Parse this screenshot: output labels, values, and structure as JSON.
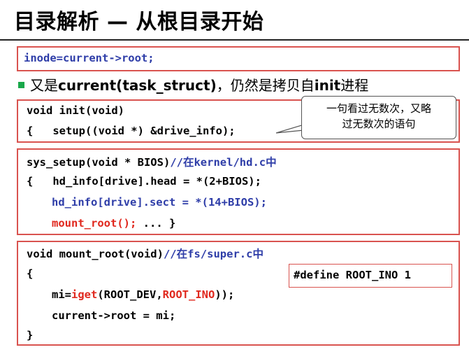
{
  "title": "目录解析 — 从根目录开始",
  "box1": {
    "line": "inode=current->root;"
  },
  "bullet": {
    "prefix": "又是",
    "mid": "current(task_struct)",
    "suffix": "，仍然是拷贝自",
    "bold": "init",
    "end": "进程"
  },
  "box2": {
    "line1": "void init(void)",
    "line2": "{   setup((void *) &drive_info);"
  },
  "callout": {
    "line1": "一句看过无数次，又略",
    "line2": "过无数次的语句"
  },
  "box3": {
    "line1_a": "sys_setup(void * BIOS)",
    "line1_b": "//在kernel/hd.c中",
    "line2": "{   hd_info[drive].head = *(2+BIOS);",
    "line3": "hd_info[drive].sect = *(14+BIOS);",
    "line4_a": "mount_root();",
    "line4_b": " ... }"
  },
  "box4": {
    "line1_a": "void mount_root(void)",
    "line1_b": "//在fs/super.c中",
    "line2": "{",
    "line3_a": "mi=",
    "line3_b": "iget",
    "line3_c": "(ROOT_DEV,",
    "line3_d": "ROOT_INO",
    "line3_e": "));",
    "line4": "current->root = mi;",
    "line5": "}"
  },
  "define": "#define ROOT_INO 1",
  "colors": {
    "accent_red": "#d9534f",
    "code_blue": "#2e3da8",
    "code_red": "#e0281e",
    "bullet_green": "#19a84a"
  }
}
